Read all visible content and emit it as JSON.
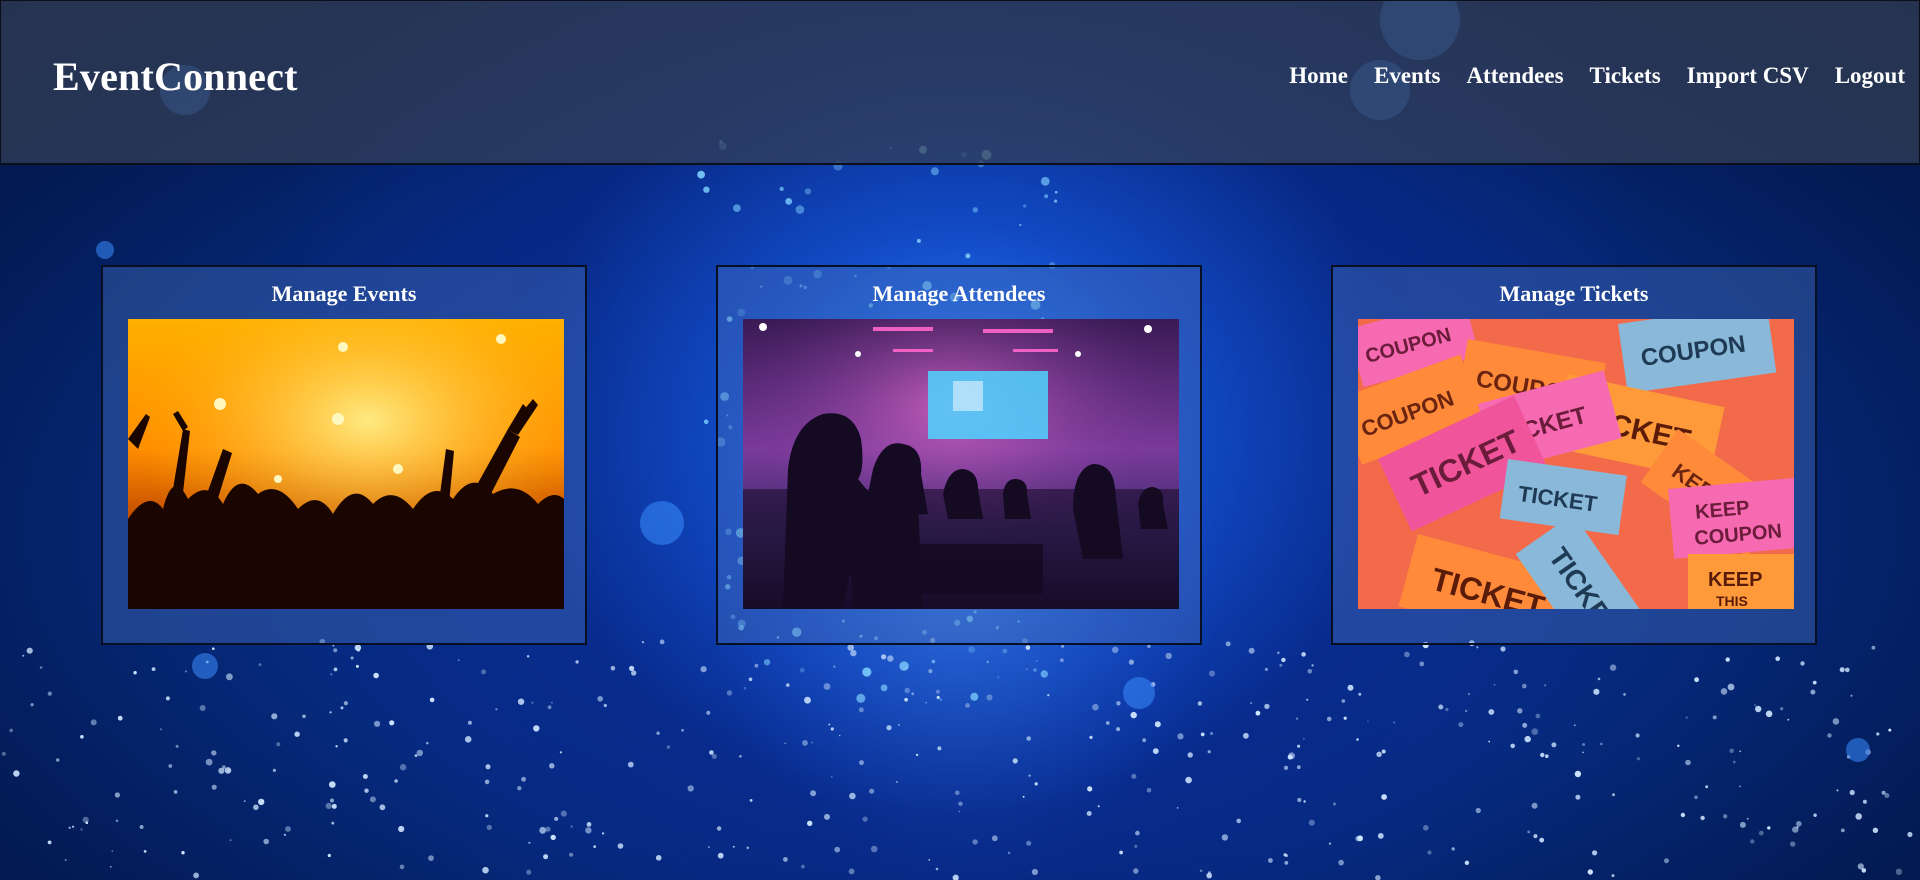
{
  "app": {
    "brand": "EventConnect"
  },
  "nav": {
    "items": [
      {
        "label": "Home"
      },
      {
        "label": "Events"
      },
      {
        "label": "Attendees"
      },
      {
        "label": "Tickets"
      },
      {
        "label": "Import CSV"
      },
      {
        "label": "Logout"
      }
    ]
  },
  "cards": [
    {
      "title": "Manage Events",
      "image": "concert-crowd-photo"
    },
    {
      "title": "Manage Attendees",
      "image": "conference-audience-photo"
    },
    {
      "title": "Manage Tickets",
      "image": "ticket-stubs-photo"
    }
  ],
  "ticket_texts": {
    "ticket": "TICKET",
    "keep": "KEEP",
    "this": "THIS",
    "coupon": "COUPON"
  },
  "colors": {
    "header_bg": "#344058",
    "card_bg": "#466eb9",
    "background": "#062a7e",
    "text": "#ffffff"
  }
}
